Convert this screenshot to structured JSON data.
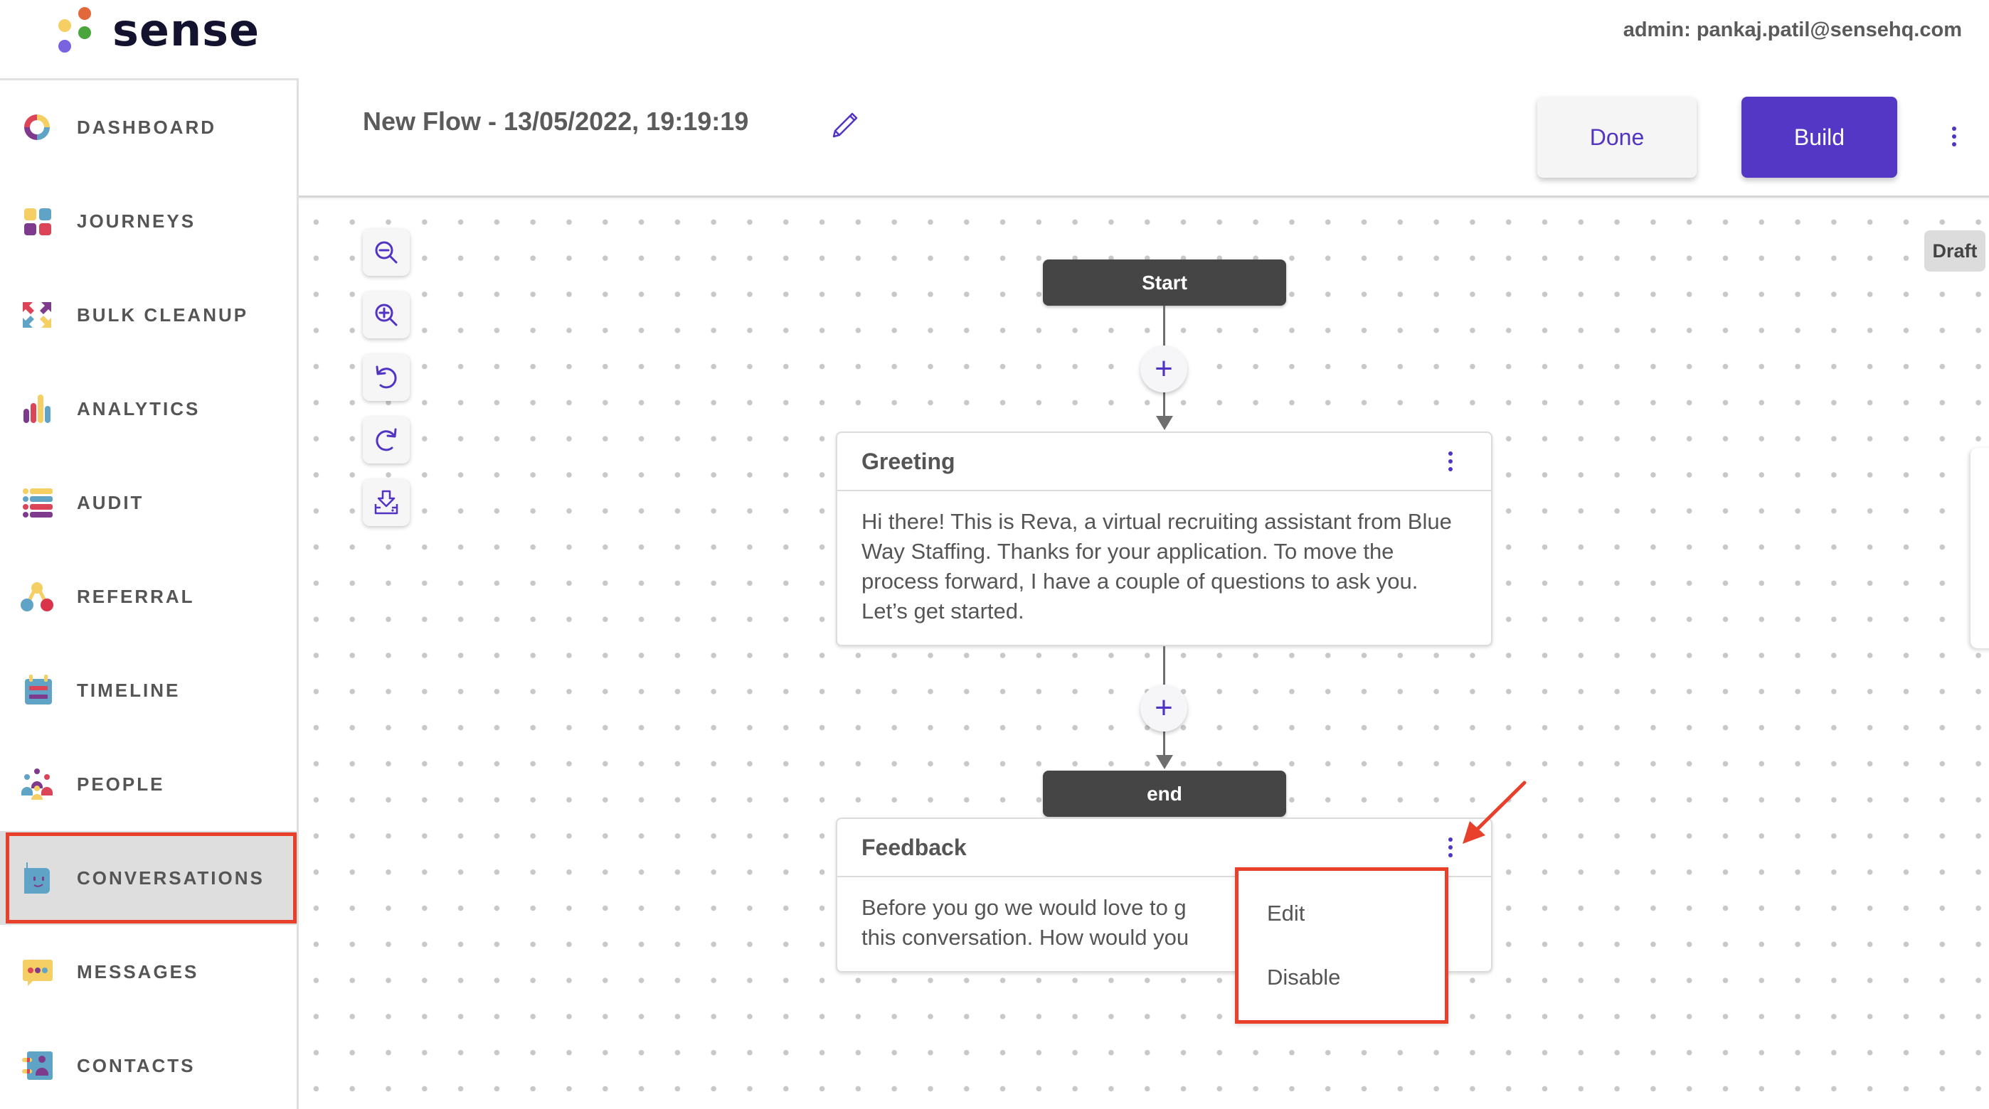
{
  "brand": {
    "name": "sense",
    "dot_colors": [
      "#e2673a",
      "#f5cf63",
      "#4aa63c",
      "#7a63e0"
    ]
  },
  "header": {
    "admin_label": "admin: pankaj.patil@sensehq.com"
  },
  "sidebar": {
    "items": [
      {
        "label": "DASHBOARD",
        "icon": "dashboard-ring-icon"
      },
      {
        "label": "JOURNEYS",
        "icon": "journeys-grid-icon"
      },
      {
        "label": "BULK CLEANUP",
        "icon": "bulk-cleanup-arrows-icon"
      },
      {
        "label": "ANALYTICS",
        "icon": "analytics-bars-icon"
      },
      {
        "label": "AUDIT",
        "icon": "audit-list-icon"
      },
      {
        "label": "REFERRAL",
        "icon": "referral-nodes-icon"
      },
      {
        "label": "TIMELINE",
        "icon": "timeline-calendar-icon"
      },
      {
        "label": "PEOPLE",
        "icon": "people-group-icon"
      },
      {
        "label": "CONVERSATIONS",
        "icon": "conversations-bot-icon",
        "active": true
      },
      {
        "label": "MESSAGES",
        "icon": "messages-bubble-icon"
      },
      {
        "label": "CONTACTS",
        "icon": "contacts-book-icon"
      }
    ]
  },
  "flow": {
    "title": "New Flow - 13/05/2022, 19:19:19",
    "done_label": "Done",
    "build_label": "Build",
    "status_badge": "Draft"
  },
  "toolbar": {
    "tools": [
      {
        "name": "zoom-out",
        "icon": "zoom-out-icon"
      },
      {
        "name": "zoom-in",
        "icon": "zoom-in-icon"
      },
      {
        "name": "undo",
        "icon": "undo-icon"
      },
      {
        "name": "redo",
        "icon": "redo-icon"
      },
      {
        "name": "download",
        "icon": "download-icon"
      }
    ]
  },
  "nodes": {
    "start_label": "Start",
    "end_label": "end",
    "greeting": {
      "title": "Greeting",
      "body": "Hi there! This is Reva, a virtual recruiting assistant from Blue Way Staffing. Thanks for your application. To move the process forward, I have a couple of questions to ask you. Let’s get started."
    },
    "feedback": {
      "title": "Feedback",
      "body_line1": "Before you go we would love to g",
      "body_line2": "this conversation. How would you"
    }
  },
  "context_menu": {
    "items": [
      "Edit",
      "Disable"
    ]
  },
  "colors": {
    "accent": "#5537c6",
    "annotation": "#e8402a",
    "node_dark": "#454545",
    "text": "#555555"
  }
}
